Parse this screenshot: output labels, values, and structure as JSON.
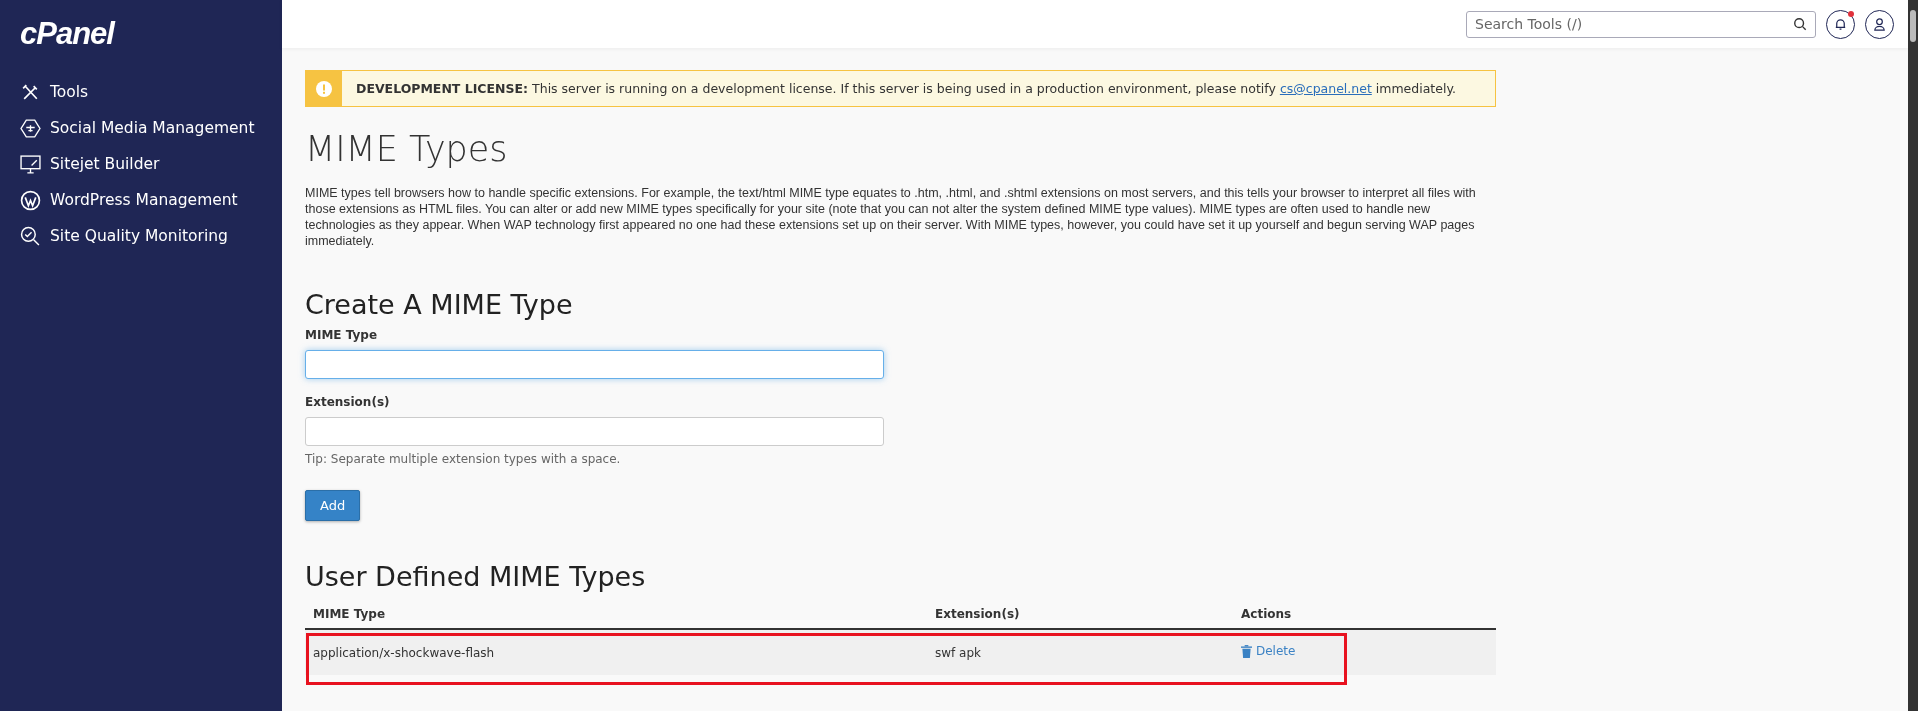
{
  "sidebar": {
    "logo": "cPanel",
    "items": [
      {
        "label": "Tools"
      },
      {
        "label": "Social Media Management"
      },
      {
        "label": "Sitejet Builder"
      },
      {
        "label": "WordPress Management"
      },
      {
        "label": "Site Quality Monitoring"
      }
    ]
  },
  "header": {
    "search": {
      "placeholder": "Search Tools (/)"
    },
    "notifications": {
      "unread": true
    }
  },
  "license_notice": {
    "title": "DEVELOPMENT LICENSE:",
    "text": "This server is running on a development license. If this server is being used in a production environment, please notify",
    "link": "cs@cpanel.net",
    "text_after": "immediately."
  },
  "page_title": "MIME Types",
  "description": "MIME types tell browsers how to handle specific extensions. For example, the text/html MIME type equates to .htm, .html, and .shtml extensions on most servers, and this tells your browser to interpret all files with those extensions as HTML files. You can alter or add new MIME types specifically for your site (note that you can not alter the system defined MIME type values). MIME types are often used to handle new technologies as they appear. When WAP technology first appeared no one had these extensions set up on their server. With MIME types, however, you could have set it up yourself and begun serving WAP pages immediately.",
  "create_form": {
    "title": "Create A MIME Type",
    "fields": [
      {
        "label": "MIME Type",
        "focused": true
      },
      {
        "label": "Extension(s)",
        "focused": false
      }
    ],
    "tip": "Tip: Separate multiple extension types with a space.",
    "button": "Add"
  },
  "user_defined": {
    "title": "User Defined MIME Types",
    "columns": [
      "MIME Type",
      "Extension(s)",
      "Actions"
    ],
    "rows": [
      {
        "mime_type": "application/x-shockwave-flash",
        "extensions": "swf apk",
        "action": "Delete",
        "highlighted": true
      }
    ]
  }
}
